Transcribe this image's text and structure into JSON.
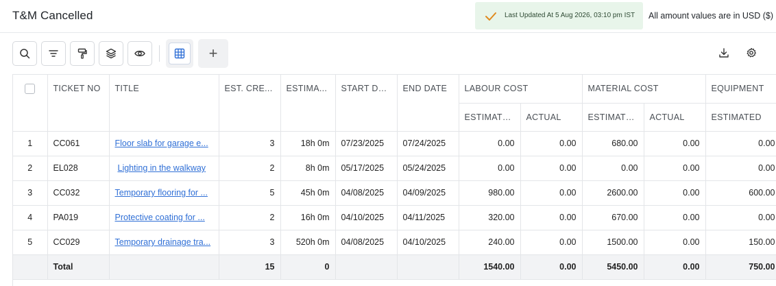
{
  "header": {
    "title": "T&M Cancelled",
    "last_updated": "Last Updated At 5 Aug 2026, 03:10 pm IST",
    "currency_note": "All amount values are in USD ($)"
  },
  "toolbar": {
    "buttons": [
      "search-icon",
      "filter-icon",
      "paint-roller-icon",
      "layers-icon",
      "eye-icon"
    ],
    "grid_view_icon": "grid-icon",
    "add_label": "+",
    "right_icons": [
      "download-icon",
      "gear-icon"
    ]
  },
  "colors": {
    "accent": "#2f6fd6",
    "badge_bg": "#e8f5ea",
    "check": "#e08a1e"
  },
  "table": {
    "headers": {
      "ticket_no": "TICKET NO",
      "title": "TITLE",
      "est_crew": "EST. CRE...",
      "estimated_hours": "ESTIMA...",
      "start_date": "START DA...",
      "end_date": "END DATE",
      "labour_cost": "LABOUR COST",
      "material_cost": "MATERIAL COST",
      "equipment": "EQUIPMENT",
      "estimated": "ESTIMATED",
      "actual": "ACTUAL"
    },
    "rows": [
      {
        "idx": "1",
        "ticket": "CC061",
        "title": "Floor slab for garage e...",
        "crew": "3",
        "hours": "18h 0m",
        "start": "07/23/2025",
        "end": "07/24/2025",
        "lab_est": "0.00",
        "lab_act": "0.00",
        "mat_est": "680.00",
        "mat_act": "0.00",
        "eq_est": "0.00"
      },
      {
        "idx": "2",
        "ticket": "EL028",
        "title": "Lighting in the walkway",
        "crew": "2",
        "hours": "8h 0m",
        "start": "05/17/2025",
        "end": "05/24/2025",
        "lab_est": "0.00",
        "lab_act": "0.00",
        "mat_est": "0.00",
        "mat_act": "0.00",
        "eq_est": "0.00"
      },
      {
        "idx": "3",
        "ticket": "CC032",
        "title": "Temporary flooring for ...",
        "crew": "5",
        "hours": "45h 0m",
        "start": "04/08/2025",
        "end": "04/09/2025",
        "lab_est": "980.00",
        "lab_act": "0.00",
        "mat_est": "2600.00",
        "mat_act": "0.00",
        "eq_est": "600.00"
      },
      {
        "idx": "4",
        "ticket": "PA019",
        "title": "Protective coating for ...",
        "crew": "2",
        "hours": "16h 0m",
        "start": "04/10/2025",
        "end": "04/11/2025",
        "lab_est": "320.00",
        "lab_act": "0.00",
        "mat_est": "670.00",
        "mat_act": "0.00",
        "eq_est": "0.00"
      },
      {
        "idx": "5",
        "ticket": "CC029",
        "title": "Temporary drainage tra...",
        "crew": "3",
        "hours": "520h 0m",
        "start": "04/08/2025",
        "end": "04/10/2025",
        "lab_est": "240.00",
        "lab_act": "0.00",
        "mat_est": "1500.00",
        "mat_act": "0.00",
        "eq_est": "150.00"
      }
    ],
    "total": {
      "label": "Total",
      "crew": "15",
      "hours": "0",
      "lab_est": "1540.00",
      "lab_act": "0.00",
      "mat_est": "5450.00",
      "mat_act": "0.00",
      "eq_est": "750.00"
    }
  }
}
